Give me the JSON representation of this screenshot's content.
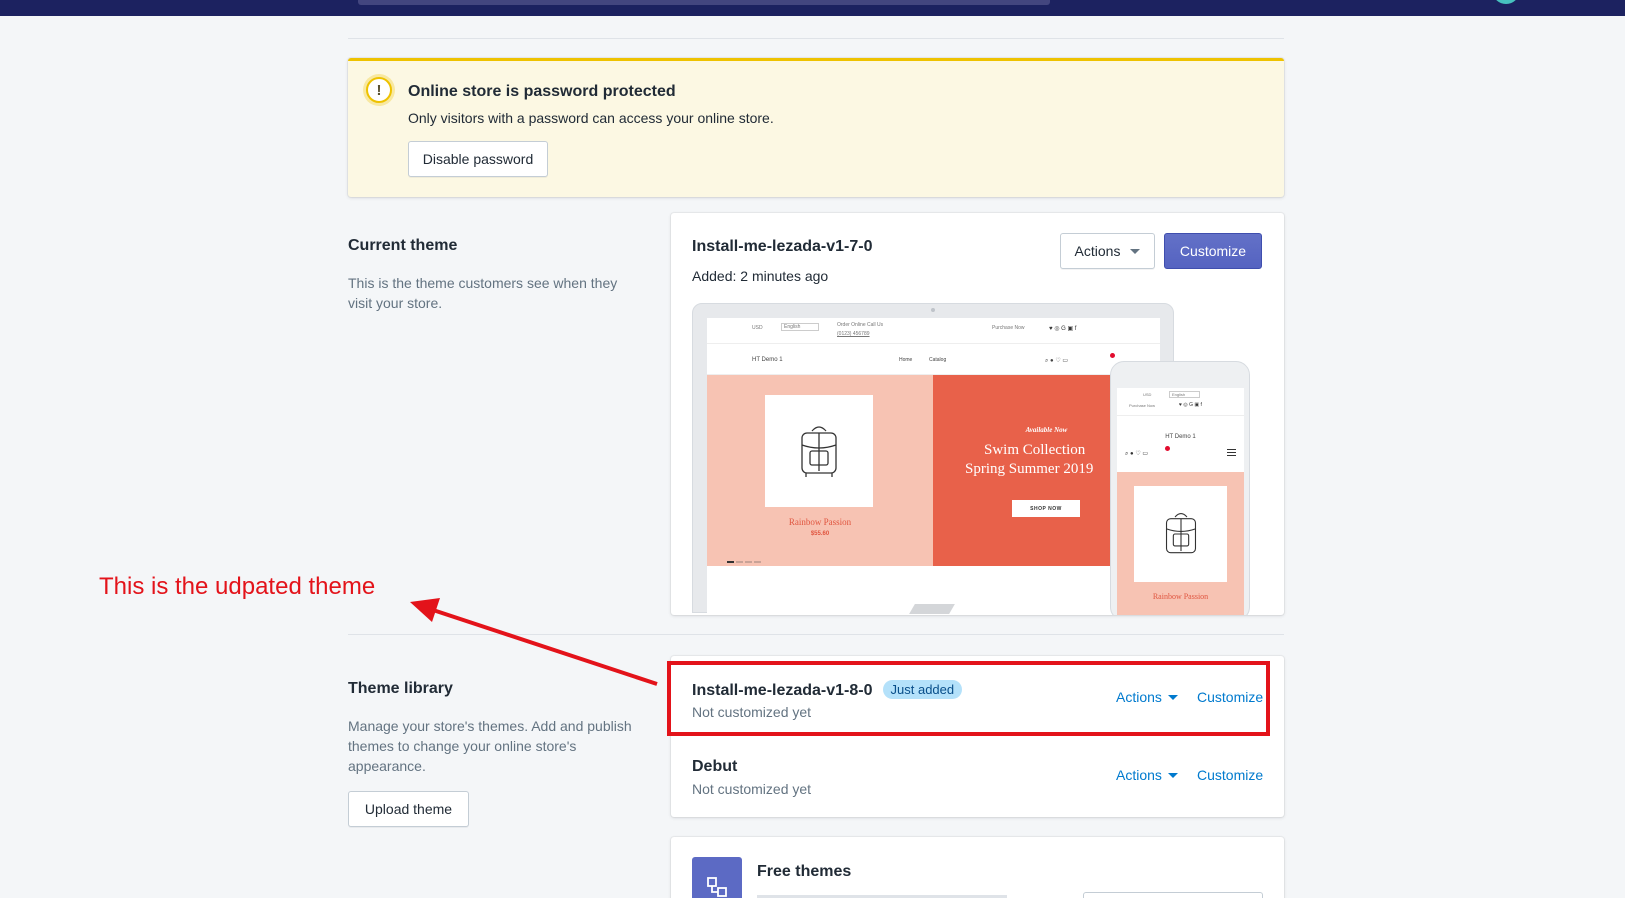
{
  "banner": {
    "title": "Online store is password protected",
    "description": "Only visitors with a password can access your online store.",
    "button_label": "Disable password",
    "icon": "alert-circle-icon",
    "accent_color": "#eec200"
  },
  "current_theme": {
    "section_title": "Current theme",
    "section_desc": "This is the theme customers see when they visit your store.",
    "theme_name": "Install-me-lezada-v1-7-0",
    "added": "Added: 2 minutes ago",
    "actions_label": "Actions",
    "customize_label": "Customize",
    "preview": {
      "currency": "USD",
      "language": "English",
      "order_line": "Order Online Call Us",
      "phone": "(0123) 456789",
      "purchase": "Purchase Now",
      "brand": "HT Demo 1",
      "nav_home": "Home",
      "nav_catalog": "Catalog",
      "product_name": "Rainbow Passion",
      "product_price": "$55.60",
      "available": "Available Now",
      "headline_1": "Swim Collection",
      "headline_2": "Spring Summer 2019",
      "shop_now": "SHOP NOW"
    }
  },
  "theme_library": {
    "section_title": "Theme library",
    "section_desc": "Manage your store's themes. Add and publish themes to change your online store's appearance.",
    "upload_label": "Upload theme",
    "items": [
      {
        "name": "Install-me-lezada-v1-8-0",
        "badge": "Just added",
        "status": "Not customized yet",
        "actions_label": "Actions",
        "customize_label": "Customize"
      },
      {
        "name": "Debut",
        "status": "Not customized yet",
        "actions_label": "Actions",
        "customize_label": "Customize"
      }
    ]
  },
  "free_themes": {
    "title": "Free themes",
    "icon": "free-themes-icon"
  },
  "annotation": {
    "text": "This is the udpated theme",
    "color": "#e3131a"
  },
  "colors": {
    "primary": "#5c6ac4",
    "link": "#007ace",
    "topbar": "#1c2260"
  }
}
